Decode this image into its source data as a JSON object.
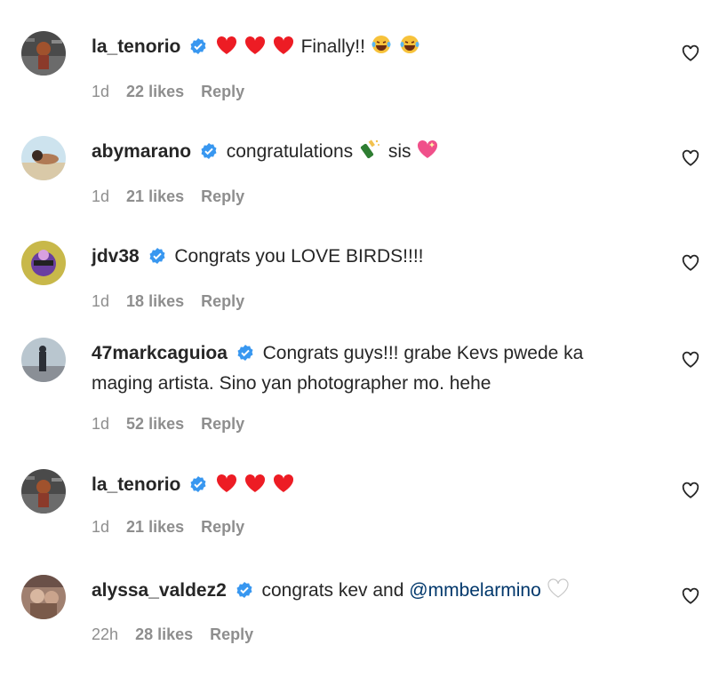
{
  "comments": [
    {
      "username": "la_tenorio",
      "verified": true,
      "emojis": [
        "red-heart",
        "red-heart",
        "red-heart"
      ],
      "text": "Finally!!",
      "trailing_emojis": [
        "laughing-tears",
        "laughing-tears"
      ],
      "time": "1d",
      "likes": "22 likes",
      "reply": "Reply"
    },
    {
      "username": "abymarano",
      "verified": true,
      "text": "congratulations",
      "mid_emoji": "champagne",
      "text2": "sis",
      "trailing_emojis": [
        "sparkling-heart"
      ],
      "time": "1d",
      "likes": "21 likes",
      "reply": "Reply"
    },
    {
      "username": "jdv38",
      "verified": true,
      "text": "Congrats you LOVE BIRDS!!!!",
      "time": "1d",
      "likes": "18 likes",
      "reply": "Reply"
    },
    {
      "username": "47markcaguioa",
      "verified": true,
      "text": "Congrats guys!!! grabe Kevs pwede ka maging artista. Sino yan photographer mo. hehe",
      "time": "1d",
      "likes": "52 likes",
      "reply": "Reply"
    },
    {
      "username": "la_tenorio",
      "verified": true,
      "emojis": [
        "red-heart",
        "red-heart",
        "red-heart"
      ],
      "time": "1d",
      "likes": "21 likes",
      "reply": "Reply"
    },
    {
      "username": "alyssa_valdez2",
      "verified": true,
      "text": "congrats kev and",
      "mention": "@mmbelarmino",
      "trailing_emojis": [
        "white-heart"
      ],
      "time": "22h",
      "likes": "28 likes",
      "reply": "Reply"
    }
  ],
  "colors": {
    "verified_blue": "#3897f0",
    "heart_red": "#ed1c24",
    "meta_gray": "#8e8e8e",
    "mention_blue": "#00376b"
  },
  "icons": {
    "verified": "verified-badge-icon",
    "like": "heart-outline-icon"
  }
}
